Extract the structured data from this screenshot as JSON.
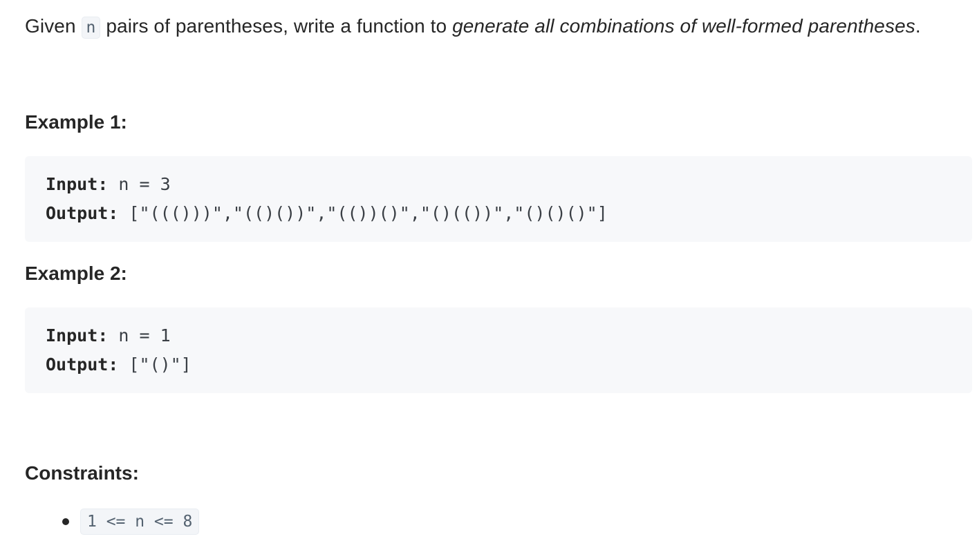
{
  "description": {
    "prefix": "Given ",
    "var": "n",
    "middle": " pairs of parentheses, write a function to ",
    "emphasis": "generate all combinations of well-formed parentheses",
    "suffix": "."
  },
  "examples": [
    {
      "heading": "Example 1:",
      "input_label": "Input:",
      "input_value": " n = 3",
      "output_label": "Output:",
      "output_value": " [\"((()))\",\"(()())\",\"(())()\",\"()(())\",\"()()()\"]"
    },
    {
      "heading": "Example 2:",
      "input_label": "Input:",
      "input_value": " n = 1",
      "output_label": "Output:",
      "output_value": " [\"()\"]"
    }
  ],
  "constraints": {
    "heading": "Constraints:",
    "items": [
      "1 <= n <= 8"
    ]
  }
}
